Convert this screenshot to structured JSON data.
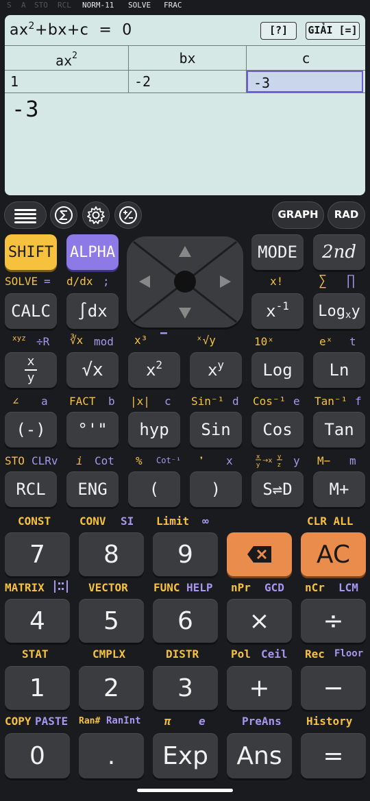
{
  "status": {
    "items": [
      "S",
      "A",
      "STO",
      "RCL",
      "NORM-11",
      "SOLVE",
      "FRAC"
    ]
  },
  "screen": {
    "equation": "ax",
    "equation_sup": "2",
    "equation_rest": "+bx+c  =  0",
    "help_button": "[?]",
    "solve_button": "GIẢI [=]",
    "headers": [
      {
        "text": "ax",
        "sup": "2"
      },
      {
        "text": "bx",
        "sup": ""
      },
      {
        "text": "c",
        "sup": ""
      }
    ],
    "values": [
      "1",
      "-2",
      "-3"
    ],
    "result": "-3"
  },
  "toolbar": {
    "graph": "GRAPH",
    "rad": "RAD"
  },
  "keys": {
    "shift": "SHIFT",
    "alpha": "ALPHA",
    "mode": "MODE",
    "second": "2nd",
    "calc": "CALC",
    "integral": "∫dx",
    "inverse_base": "x",
    "inverse_sup": "-1",
    "log_base_a": "Log",
    "log_base_b": "x",
    "log_base_c": "y",
    "frac_num": "x",
    "frac_den": "y",
    "sqrt": "√x",
    "square_base": "x",
    "square_sup": "2",
    "power_base": "x",
    "power_sup": "y",
    "log": "Log",
    "ln": "Ln",
    "neg": "(-)",
    "dms": "°'\"",
    "hyp": "hyp",
    "sin": "Sin",
    "cos": "Cos",
    "tan": "Tan",
    "rcl": "RCL",
    "eng": "ENG",
    "lparen": "(",
    "rparen": ")",
    "sd": "S⇌D",
    "mplus": "M+",
    "n7": "7",
    "n8": "8",
    "n9": "9",
    "ac": "AC",
    "n4": "4",
    "n5": "5",
    "n6": "6",
    "times": "×",
    "divide": "÷",
    "n1": "1",
    "n2": "2",
    "n3": "3",
    "plus": "+",
    "minus": "−",
    "n0": "0",
    "dot": ".",
    "exp": "Exp",
    "ans": "Ans",
    "equals": "="
  },
  "labels": {
    "row1": [
      "SOLVE",
      "=",
      "d/dx",
      ";",
      "x!",
      "∑",
      "∏"
    ],
    "row2": [
      "x",
      "y",
      "z",
      "÷R",
      "∛x",
      "mod",
      "x³",
      "▔",
      "ˣ√y",
      "10ˣ",
      "eˣ",
      "t"
    ],
    "row3": [
      "∠",
      "a",
      "FACT",
      "b",
      "|x|",
      "c",
      "Sin⁻¹",
      "d",
      "Cos⁻¹",
      "e",
      "Tan⁻¹",
      "f"
    ],
    "row4": [
      "STO",
      "CLRv",
      "i",
      "Cot",
      "%",
      "Cot⁻¹",
      "❜",
      "x",
      "y",
      "M−",
      "m"
    ],
    "row5": [
      "CONST",
      "CONV",
      "SI",
      "Limit",
      "∞",
      "CLR ALL"
    ],
    "row6": [
      "MATRIX",
      "VECTOR",
      "FUNC",
      "HELP",
      "nPr",
      "GCD",
      "nCr",
      "LCM"
    ],
    "row7": [
      "STAT",
      "CMPLX",
      "DISTR",
      "Pol",
      "Ceil",
      "Rec",
      "Floor"
    ],
    "row8": [
      "COPY",
      "PASTE",
      "Ran#",
      "RanInt",
      "π",
      "e",
      "PreAns",
      "History"
    ]
  }
}
